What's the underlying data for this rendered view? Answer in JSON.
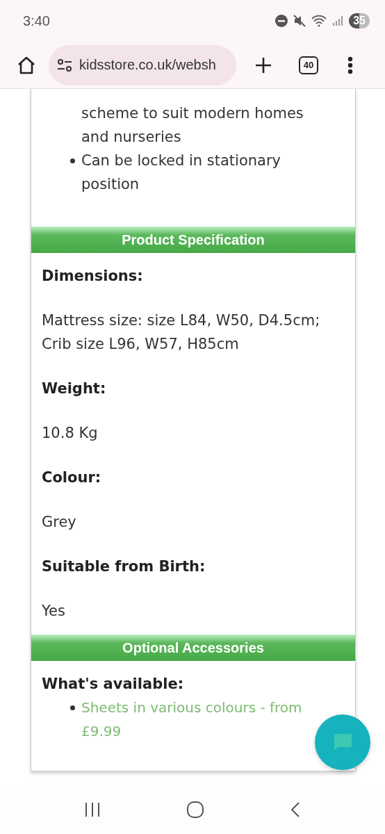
{
  "status_bar": {
    "time": "3:40",
    "battery": "35"
  },
  "browser_toolbar": {
    "url": "kidsstore.co.uk/websh",
    "tab_count": "40"
  },
  "features": [
    {
      "text": "scheme to suit modern homes and nurseries",
      "continued": true
    },
    {
      "text": "Can be locked in stationary position",
      "continued": false
    }
  ],
  "sections": [
    {
      "title": "Product Specification",
      "blocks": [
        {
          "kind": "heading",
          "text": "Dimensions:"
        },
        {
          "kind": "paragraph",
          "lines": [
            "Mattress size: size L84, W50, D4.5cm;",
            "Crib size L96, W57, H85cm"
          ]
        },
        {
          "kind": "heading",
          "text": "Weight:"
        },
        {
          "kind": "paragraph",
          "text": "10.8 Kg"
        },
        {
          "kind": "heading",
          "text": "Colour:"
        },
        {
          "kind": "paragraph",
          "text": "Grey"
        },
        {
          "kind": "heading",
          "text": "Suitable from Birth:"
        },
        {
          "kind": "paragraph",
          "text": "Yes"
        }
      ]
    },
    {
      "title": "Optional Accessories",
      "blocks": [
        {
          "kind": "heading",
          "text": "What's available:"
        },
        {
          "kind": "link_item",
          "text": "Sheets in various colours - from £9.99"
        }
      ]
    }
  ]
}
